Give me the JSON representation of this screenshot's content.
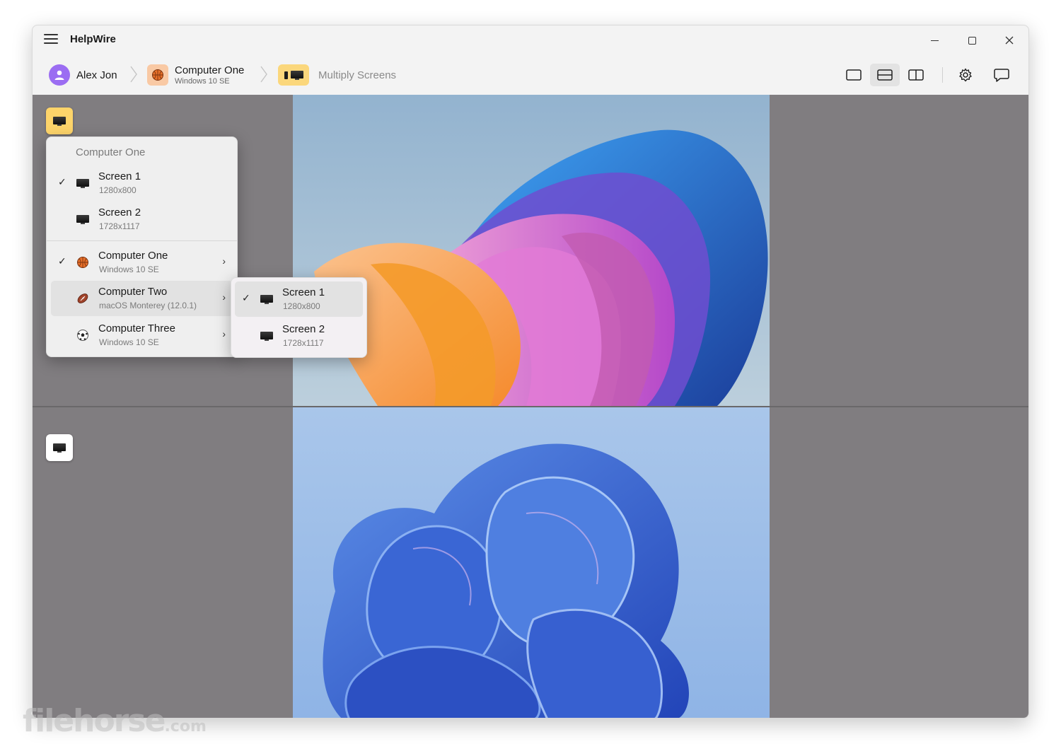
{
  "window": {
    "title": "HelpWire"
  },
  "breadcrumb": {
    "user": {
      "name": "Alex Jon"
    },
    "computer": {
      "name": "Computer One",
      "os": "Windows 10 SE"
    },
    "current": {
      "label": "Multiply Screens"
    }
  },
  "toolbar": {
    "layouts": [
      "single-view",
      "split-horizontal",
      "split-vertical"
    ],
    "active_layout": "split-horizontal"
  },
  "colors": {
    "accent_tile": "#fdd46a",
    "avatar": "#9b6df2",
    "content_bg": "#807d80"
  },
  "screen_menu": {
    "header": "Computer One",
    "screens": [
      {
        "label": "Screen 1",
        "resolution": "1280x800",
        "checked": true
      },
      {
        "label": "Screen 2",
        "resolution": "1728x1117",
        "checked": false
      }
    ],
    "computers": [
      {
        "name": "Computer One",
        "os": "Windows 10 SE",
        "checked": true,
        "icon": "basketball-icon"
      },
      {
        "name": "Computer Two",
        "os": "macOS Monterey (12.0.1)",
        "checked": false,
        "icon": "football-icon"
      },
      {
        "name": "Computer Three",
        "os": "Windows 10 SE",
        "checked": false,
        "icon": "soccer-ball-icon"
      }
    ]
  },
  "submenu": {
    "screens": [
      {
        "label": "Screen 1",
        "resolution": "1280x800",
        "checked": true
      },
      {
        "label": "Screen 2",
        "resolution": "1728x1117",
        "checked": false
      }
    ]
  },
  "watermark": {
    "brand": "filehorse",
    "tld": ".com"
  }
}
